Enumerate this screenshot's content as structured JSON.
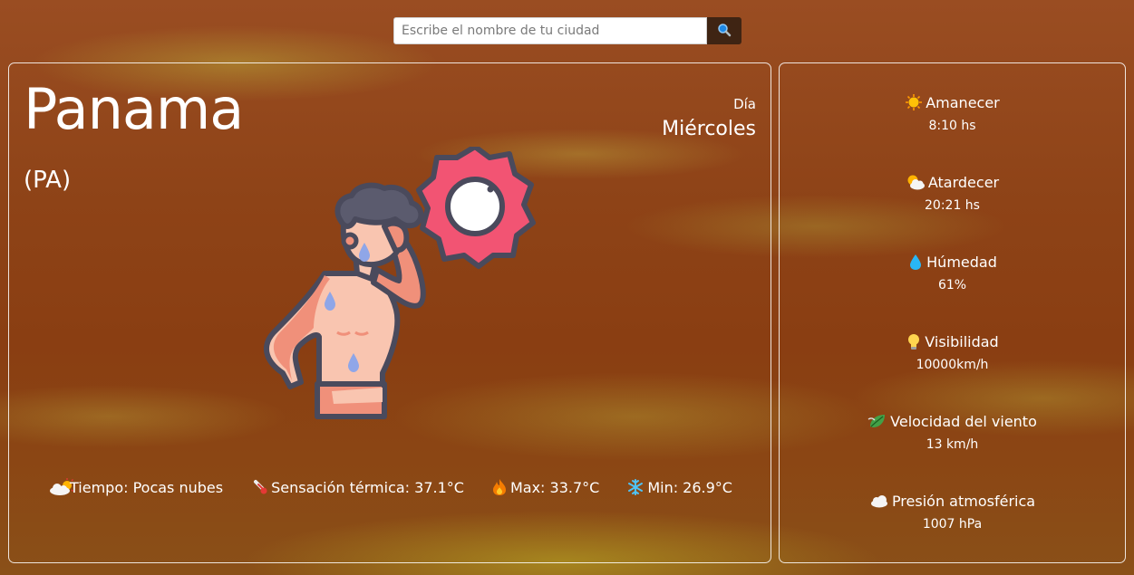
{
  "search": {
    "placeholder": "Escribe el nombre de tu ciudad",
    "button_icon": "magnifier-icon"
  },
  "weather": {
    "city": "Panama",
    "country": "(PA)",
    "day_label": "Día",
    "day_name": "Miércoles",
    "illustration": "hot-person-sun-illustration",
    "stats": {
      "tiempo": "Tiempo: Pocas nubes",
      "sensacion": "Sensación térmica: 37.1°C",
      "max": "Max: 33.7°C",
      "min": "Min: 26.9°C"
    }
  },
  "details": {
    "amanecer": {
      "label": "Amanecer",
      "value": "8:10 hs",
      "icon": "sun-icon"
    },
    "atardecer": {
      "label": "Atardecer",
      "value": "20:21 hs",
      "icon": "sun-behind-cloud-icon"
    },
    "humedad": {
      "label": "Húmedad",
      "value": "61%",
      "icon": "droplet-icon"
    },
    "visibilidad": {
      "label": "Visibilidad",
      "value": "10000km/h",
      "icon": "lightbulb-icon"
    },
    "viento": {
      "label": "Velocidad del viento",
      "value": "13 km/h",
      "icon": "leaf-wind-icon"
    },
    "presion": {
      "label": "Presión atmosférica",
      "value": "1007 hPa",
      "icon": "cloud-icon"
    }
  },
  "colors": {
    "search_button_bg": "#3f2413",
    "panel_border": "#ffffff",
    "sun_badge": "#f25473",
    "outline": "#4a4a5c"
  }
}
